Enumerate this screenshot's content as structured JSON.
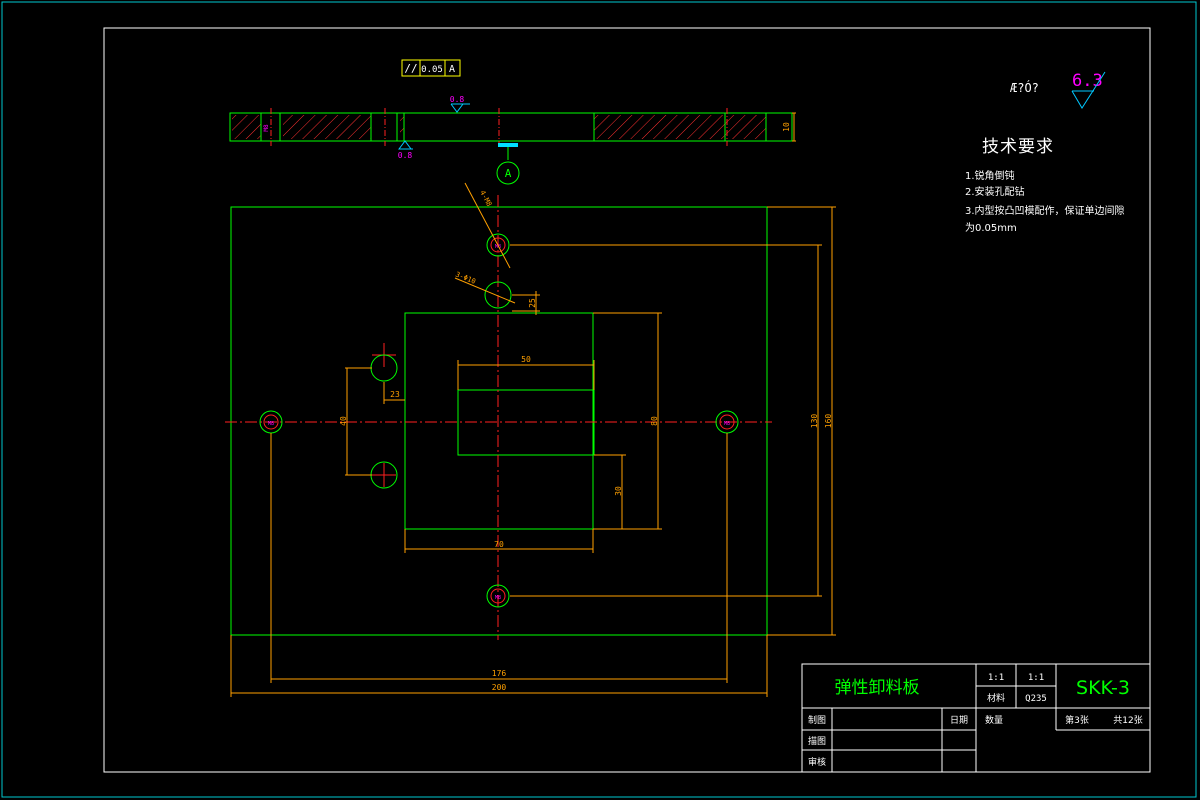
{
  "drawing": {
    "tolerance_frame": {
      "symbol": "//",
      "value": "0.05",
      "datum": "A"
    },
    "roughness_top": "0.8",
    "roughness_bottom": "0.8",
    "datum_label": "A",
    "thickness_dim": "10",
    "other_roughness_text": "Æ?Ó?",
    "general_roughness": "6.3",
    "pin_hole_label": "4-M8",
    "upper_hole_label": "3-Φ10",
    "dims": {
      "d25_right": "25",
      "d23": "23",
      "d50": "50",
      "d40": "40",
      "d80": "80",
      "d30": "30",
      "d70": "70",
      "d130": "130",
      "d160": "160",
      "d176": "176",
      "d200": "200"
    },
    "hole_tag": "M8"
  },
  "tech_requirements": {
    "title": "技术要求",
    "items": [
      "1.锐角倒钝",
      "2.安装孔配钻",
      "3.内型按凸凹模配作，保证单边间隙",
      "为0.05mm"
    ]
  },
  "title_block": {
    "part_name": "弹性卸料板",
    "scale1": "1:1",
    "scale2": "1:1",
    "material_label": "材料",
    "material": "Q235",
    "drawing_no": "SKK-3",
    "row_draw": "制图",
    "row_design": "描图",
    "row_check": "审核",
    "date_label": "日期",
    "qty_label": "数量",
    "sheet": "第3张",
    "total": "共12张"
  }
}
